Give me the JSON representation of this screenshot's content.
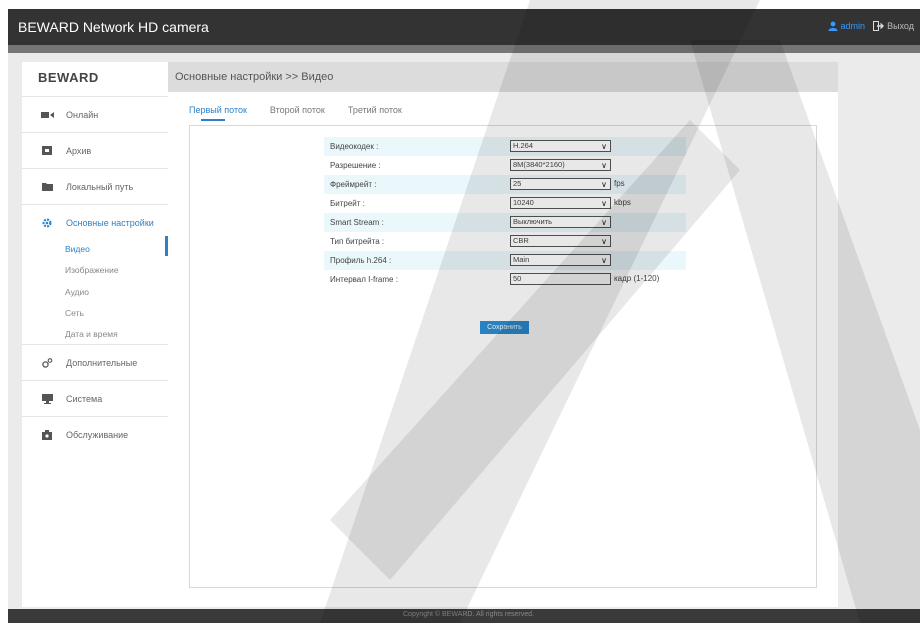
{
  "header": {
    "title": "BEWARD Network HD camera",
    "user": "admin",
    "logout": "Выход"
  },
  "sidebar": {
    "logo": "BEWARD",
    "items": [
      {
        "label": "Онлайн",
        "icon": "video-icon"
      },
      {
        "label": "Архив",
        "icon": "archive-icon"
      },
      {
        "label": "Локальный путь",
        "icon": "folder-icon"
      },
      {
        "label": "Основные настройки",
        "icon": "gear-icon",
        "active": true
      },
      {
        "label": "Дополнительные",
        "icon": "gears-icon"
      },
      {
        "label": "Система",
        "icon": "monitor-icon"
      },
      {
        "label": "Обслуживание",
        "icon": "maintenance-icon"
      }
    ],
    "subitems": [
      {
        "label": "Видео",
        "active": true
      },
      {
        "label": "Изображение"
      },
      {
        "label": "Аудио"
      },
      {
        "label": "Сеть"
      },
      {
        "label": "Дата и время"
      }
    ]
  },
  "main": {
    "title": "Основные настройки >> Видео",
    "tabs": [
      "Первый поток",
      "Второй поток",
      "Третий поток"
    ],
    "form": [
      {
        "label": "Видеокодек :",
        "type": "select",
        "value": "H.264",
        "unit": ""
      },
      {
        "label": "Разрешение :",
        "type": "select",
        "value": "8M(3840*2160)",
        "unit": ""
      },
      {
        "label": "Фреймрейт :",
        "type": "select",
        "value": "25",
        "unit": "fps"
      },
      {
        "label": "Битрейт :",
        "type": "select",
        "value": "10240",
        "unit": "kbps"
      },
      {
        "label": "Smart Stream :",
        "type": "select",
        "value": "Выключить",
        "unit": ""
      },
      {
        "label": "Тип битрейта :",
        "type": "select",
        "value": "CBR",
        "unit": ""
      },
      {
        "label": "Профиль h.264 :",
        "type": "select",
        "value": "Main",
        "unit": ""
      },
      {
        "label": "Интервал I-frame :",
        "type": "input",
        "value": "50",
        "unit": "кадр (1-120)"
      }
    ],
    "save_label": "Сохранить"
  },
  "footer": {
    "copyright": "Copyright © BEWARD. All rights reserved."
  },
  "colors": {
    "accent": "#2b82c9",
    "topbar": "#333333",
    "row_shade": "#eaf7fb"
  }
}
